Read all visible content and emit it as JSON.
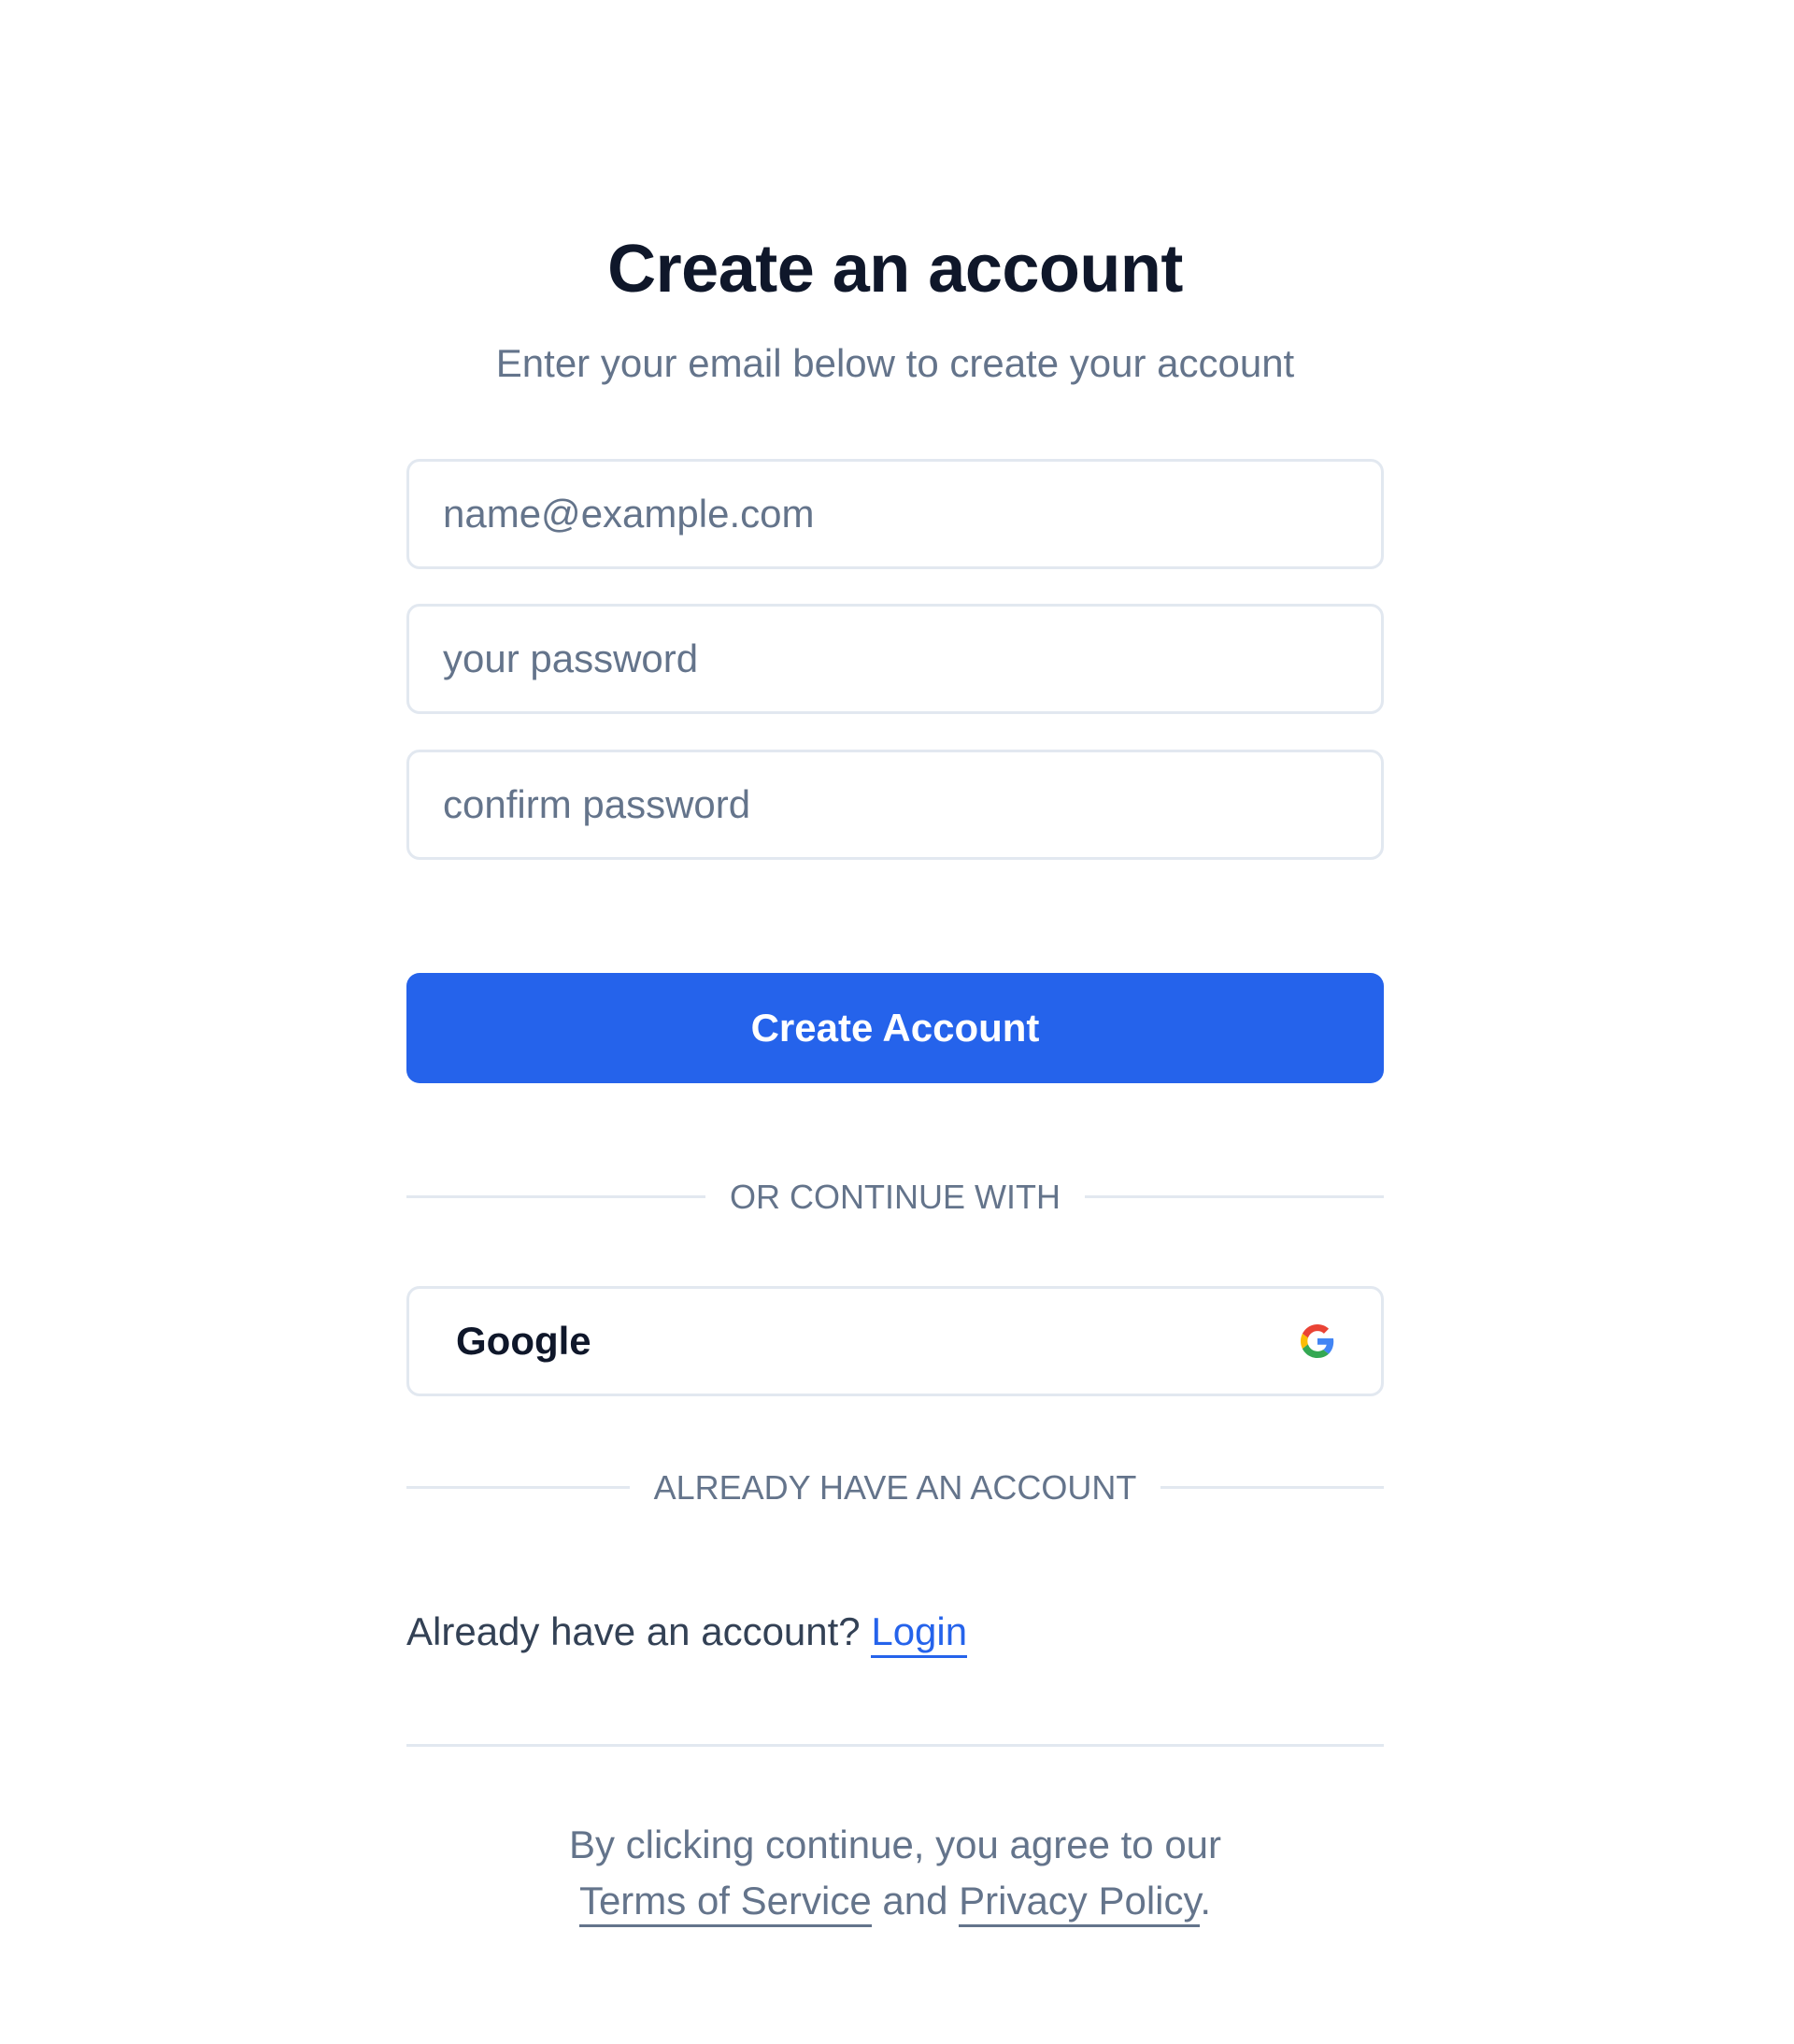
{
  "header": {
    "title": "Create an account",
    "subtitle": "Enter your email below to create your account"
  },
  "form": {
    "email": {
      "value": "",
      "placeholder": "name@example.com"
    },
    "password": {
      "value": "",
      "placeholder": "your password"
    },
    "confirm_password": {
      "value": "",
      "placeholder": "confirm password"
    },
    "submit_label": "Create Account"
  },
  "divider_continue": "OR CONTINUE WITH",
  "google": {
    "label": "Google",
    "icon": "google-icon"
  },
  "divider_existing": "ALREADY HAVE AN ACCOUNT",
  "login": {
    "prompt": "Already have an account?",
    "link": "Login"
  },
  "legal": {
    "prefix": "By clicking continue, you agree to our",
    "terms": "Terms of Service",
    "and": "and",
    "privacy": "Privacy Policy",
    "suffix": "."
  },
  "colors": {
    "primary": "#2563eb",
    "text": "#0f172a",
    "muted": "#64748b",
    "border": "#e2e8f0"
  }
}
